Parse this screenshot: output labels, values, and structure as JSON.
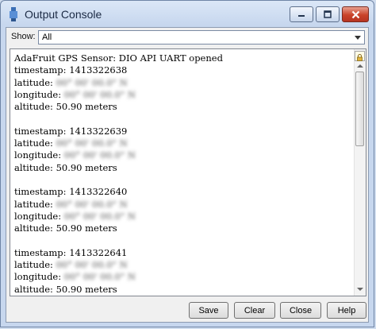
{
  "window": {
    "title": "Output Console",
    "colors": {
      "close_button": "#c9432a",
      "titlebar": "#dbe7f7",
      "content": "#ffffff"
    }
  },
  "filter": {
    "label": "Show:",
    "selected": "All"
  },
  "console": {
    "header": "AdaFruit GPS Sensor: DIO API UART opened",
    "labels": {
      "timestamp": "timestamp: ",
      "latitude": "latitude: ",
      "longitude": "longitude: ",
      "altitude": "altitude: "
    },
    "redacted": "00° 00' 00.0\" N",
    "entries": [
      {
        "timestamp": "1413322638",
        "altitude": "50.90 meters"
      },
      {
        "timestamp": "1413322639",
        "altitude": "50.90 meters"
      },
      {
        "timestamp": "1413322640",
        "altitude": "50.90 meters"
      },
      {
        "timestamp": "1413322641",
        "altitude": "50.90 meters"
      }
    ]
  },
  "buttons": {
    "save": "Save",
    "clear": "Clear",
    "close": "Close",
    "help": "Help"
  }
}
